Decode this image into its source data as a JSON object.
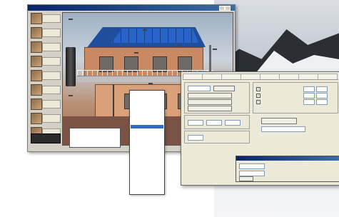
{
  "main_window": {
    "sidebar_items": [
      {
        "label": "",
        "icon": "house-thumb-icon"
      },
      {
        "label": "",
        "icon": "house-thumb-icon"
      },
      {
        "label": "",
        "icon": "house-thumb-icon"
      },
      {
        "label": "",
        "icon": "house-thumb-icon"
      },
      {
        "label": "",
        "icon": "house-thumb-icon"
      },
      {
        "label": "",
        "icon": "house-thumb-icon"
      },
      {
        "label": "",
        "icon": "house-thumb-icon"
      },
      {
        "label": "",
        "icon": "house-thumb-icon"
      },
      {
        "label": "",
        "icon": "house-thumb-icon"
      }
    ],
    "scene_labels": [
      "",
      "",
      "",
      "",
      "",
      "",
      ""
    ]
  },
  "dialog": {
    "tabs": [
      "",
      "",
      "",
      "",
      "",
      "",
      "",
      ""
    ],
    "dropdown_items": [
      "",
      "",
      "",
      "",
      "",
      "",
      "",
      "",
      "",
      "",
      "",
      "",
      "",
      "",
      "",
      "",
      "",
      "",
      "",
      "",
      "",
      "",
      "",
      ""
    ],
    "selected_index": 8
  },
  "colors": {
    "title_bar": "#0a246a",
    "solar_panel": "#1e4e9c",
    "selection": "#316ac5",
    "dialog_bg": "#ece9d8"
  }
}
